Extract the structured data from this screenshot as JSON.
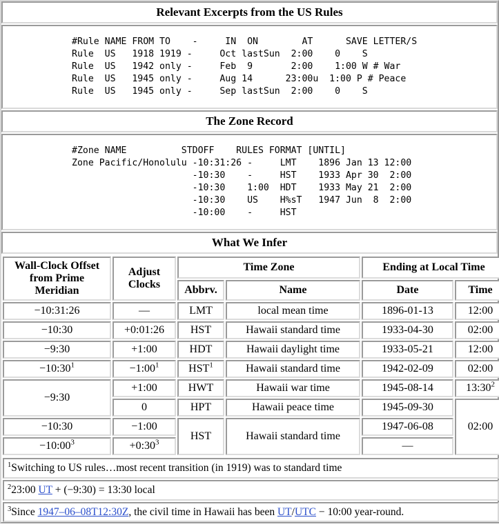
{
  "sections": {
    "rules": {
      "title": "Relevant Excerpts from the US Rules",
      "code": "#Rule NAME FROM TO    -     IN  ON        AT      SAVE LETTER/S\nRule  US   1918 1919 -     Oct lastSun  2:00    0    S\nRule  US   1942 only -     Feb  9       2:00    1:00 W # War\nRule  US   1945 only -     Aug 14      23:00u  1:00 P # Peace\nRule  US   1945 only -     Sep lastSun  2:00    0    S"
    },
    "zone": {
      "title": "The Zone Record",
      "code": "#Zone NAME          STDOFF    RULES FORMAT [UNTIL]\nZone Pacific/Honolulu -10:31:26 -     LMT    1896 Jan 13 12:00\n                      -10:30    -     HST    1933 Apr 30  2:00\n                      -10:30    1:00  HDT    1933 May 21  2:00\n                      -10:30    US    H%sT   1947 Jun  8  2:00\n                      -10:00    -     HST"
    },
    "infer": {
      "title": "What We Infer",
      "headers": {
        "offset": "Wall-Clock Offset from Prime Meridian",
        "adjust": "Adjust Clocks",
        "timezone": "Time Zone",
        "ending": "Ending at Local Time",
        "abbrv": "Abbrv.",
        "name": "Name",
        "date": "Date",
        "time": "Time"
      },
      "rows": [
        {
          "offset": "−10:31:26",
          "adjust": "—",
          "abbrv": "LMT",
          "name": "local mean time",
          "date": "1896-01-13",
          "time": "12:00"
        },
        {
          "offset": "−10:30",
          "adjust": "+0:01:26",
          "abbrv": "HST",
          "name": "Hawaii standard time",
          "date": "1933-04-30",
          "time": "02:00"
        },
        {
          "offset": "−9:30",
          "adjust": "+1:00",
          "abbrv": "HDT",
          "name": "Hawaii daylight time",
          "date": "1933-05-21",
          "time": "12:00"
        },
        {
          "offset": "−10:30",
          "offset_sup": "1",
          "adjust": "−1:00",
          "adjust_sup": "1",
          "abbrv": "HST",
          "abbrv_sup": "1",
          "name": "Hawaii standard time",
          "date": "1942-02-09",
          "time": "02:00"
        },
        {
          "offset": "−9:30",
          "adjust": "+1:00",
          "abbrv": "HWT",
          "name": "Hawaii war time",
          "date": "1945-08-14",
          "time": "13:30",
          "time_sup": "2"
        },
        {
          "adjust": "0",
          "abbrv": "HPT",
          "name": "Hawaii peace time",
          "date": "1945-09-30",
          "time": "02:00"
        },
        {
          "offset": "−10:30",
          "adjust": "−1:00",
          "abbrv": "HST",
          "name": "Hawaii standard time",
          "date": "1947-06-08"
        },
        {
          "offset": "−10:00",
          "offset_sup": "3",
          "adjust": "+0:30",
          "adjust_sup": "3",
          "date": "—"
        }
      ]
    }
  },
  "footnotes": {
    "one": {
      "marker": "1",
      "text": "Switching to US rules…most recent transition (in 1919) was to standard time"
    },
    "two": {
      "marker": "2",
      "pre": "23:00 ",
      "link": "UT",
      "post": " + (−9:30) = 13:30 local"
    },
    "three": {
      "marker": "3",
      "pre": "Since ",
      "link_date": "1947–06–08T12:30Z",
      "mid": ", the civil time in Hawaii has been ",
      "link_ut": "UT",
      "slash": "/",
      "link_utc": "UTC",
      "post": " − 10:00 year-round."
    }
  },
  "colors": {
    "link": "#2a4ecb",
    "border_dark": "#9a9a9a",
    "border_light": "#dcdcdc",
    "background": "#ffffff",
    "text": "#000000"
  }
}
